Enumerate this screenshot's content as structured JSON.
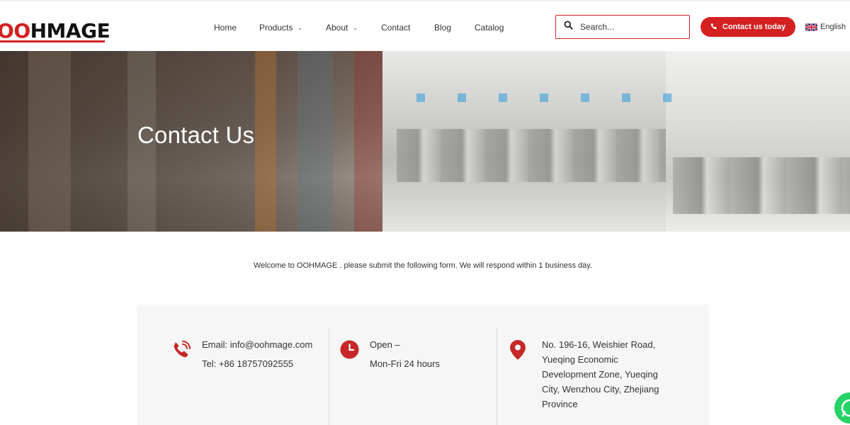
{
  "brand": {
    "logo_text_a": "O",
    "logo_text_b": "O",
    "logo_text_c": "HMAGE",
    "name": "OOHMAGE"
  },
  "nav": {
    "items": [
      {
        "label": "Home",
        "has_dropdown": false
      },
      {
        "label": "Products",
        "has_dropdown": true
      },
      {
        "label": "About",
        "has_dropdown": true
      },
      {
        "label": "Contact",
        "has_dropdown": false
      },
      {
        "label": "Blog",
        "has_dropdown": false
      },
      {
        "label": "Catalog",
        "has_dropdown": false
      }
    ]
  },
  "search": {
    "placeholder": "Search...",
    "value": ""
  },
  "cta": {
    "label": "Contact us today"
  },
  "language": {
    "label": "English"
  },
  "hero": {
    "title": "Contact Us"
  },
  "welcome": {
    "text": "Welcome to OOHMAGE . please submit the following form. We will respond within 1 business day."
  },
  "contact": {
    "email": "Email: info@oohmage.com",
    "tel": "Tel: +86 18757092555",
    "hours_line1": "Open –",
    "hours_line2": "Mon-Fri 24 hours",
    "address": [
      "No. 196-16, Weishier Road,",
      "Yueqing Economic",
      "Development Zone, Yueqing",
      "City, Wenzhou City, Zhejiang",
      "Province"
    ]
  },
  "colors": {
    "accent": "#d42020",
    "panel_bg": "#f6f6f6",
    "whatsapp": "#25d366"
  },
  "icons": {
    "search": "search-icon",
    "phone": "phone-icon",
    "clock": "clock-icon",
    "location": "location-pin-icon",
    "flag": "uk-flag-icon",
    "whatsapp": "whatsapp-icon"
  }
}
